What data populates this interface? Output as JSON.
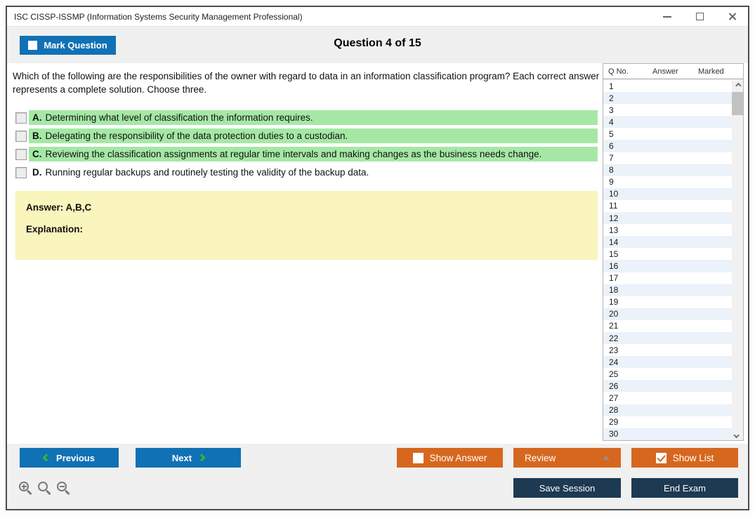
{
  "window": {
    "title": "ISC CISSP-ISSMP (Information Systems Security Management Professional)"
  },
  "header": {
    "mark_question_label": "Mark Question",
    "mark_question_checked": false,
    "question_counter": "Question 4 of 15"
  },
  "question": {
    "text": "Which of the following are the responsibilities of the owner with regard to data in an information classification program? Each correct answer represents a complete solution. Choose three.",
    "options": [
      {
        "letter": "A.",
        "text": "Determining what level of classification the information requires.",
        "highlighted": true,
        "checked": false
      },
      {
        "letter": "B.",
        "text": "Delegating the responsibility of the data protection duties to a custodian.",
        "highlighted": true,
        "checked": false
      },
      {
        "letter": "C.",
        "text": "Reviewing the classification assignments at regular time intervals and making changes as the business needs change.",
        "highlighted": true,
        "checked": false
      },
      {
        "letter": "D.",
        "text": "Running regular backups and routinely testing the validity of the backup data.",
        "highlighted": false,
        "checked": false
      }
    ],
    "answer_label": "Answer: A,B,C",
    "explanation_label": "Explanation:"
  },
  "question_list": {
    "columns": [
      "Q No.",
      "Answer",
      "Marked"
    ],
    "rows": [
      "1",
      "2",
      "3",
      "4",
      "5",
      "6",
      "7",
      "8",
      "9",
      "10",
      "11",
      "12",
      "13",
      "14",
      "15",
      "16",
      "17",
      "18",
      "19",
      "20",
      "21",
      "22",
      "23",
      "24",
      "25",
      "26",
      "27",
      "28",
      "29",
      "30"
    ]
  },
  "footer": {
    "previous_label": "Previous",
    "next_label": "Next",
    "show_answer_label": "Show Answer",
    "show_answer_checked": false,
    "review_label": "Review",
    "show_list_label": "Show List",
    "show_list_checked": true,
    "save_session_label": "Save Session",
    "end_exam_label": "End Exam"
  },
  "icons": {
    "titlebar": [
      "minimize-icon",
      "maximize-icon",
      "close-icon"
    ],
    "zoom_controls": [
      "zoom-in-icon",
      "zoom-reset-icon",
      "zoom-out-icon"
    ],
    "navigation": [
      "chevron-left-icon",
      "chevron-right-icon"
    ],
    "review_dropdown": "triangle-up-icon",
    "scrollbar": [
      "scroll-up-icon",
      "scroll-down-icon"
    ]
  },
  "colors": {
    "accent_blue": "#1171B5",
    "accent_orange": "#D6671F",
    "dark_navy": "#1D3A52",
    "option_highlight_green": "#A5E8A5",
    "answer_box_yellow": "#FAF4BD",
    "list_alt_row": "#EBF2F9",
    "chevron_green": "#3CB03C"
  }
}
